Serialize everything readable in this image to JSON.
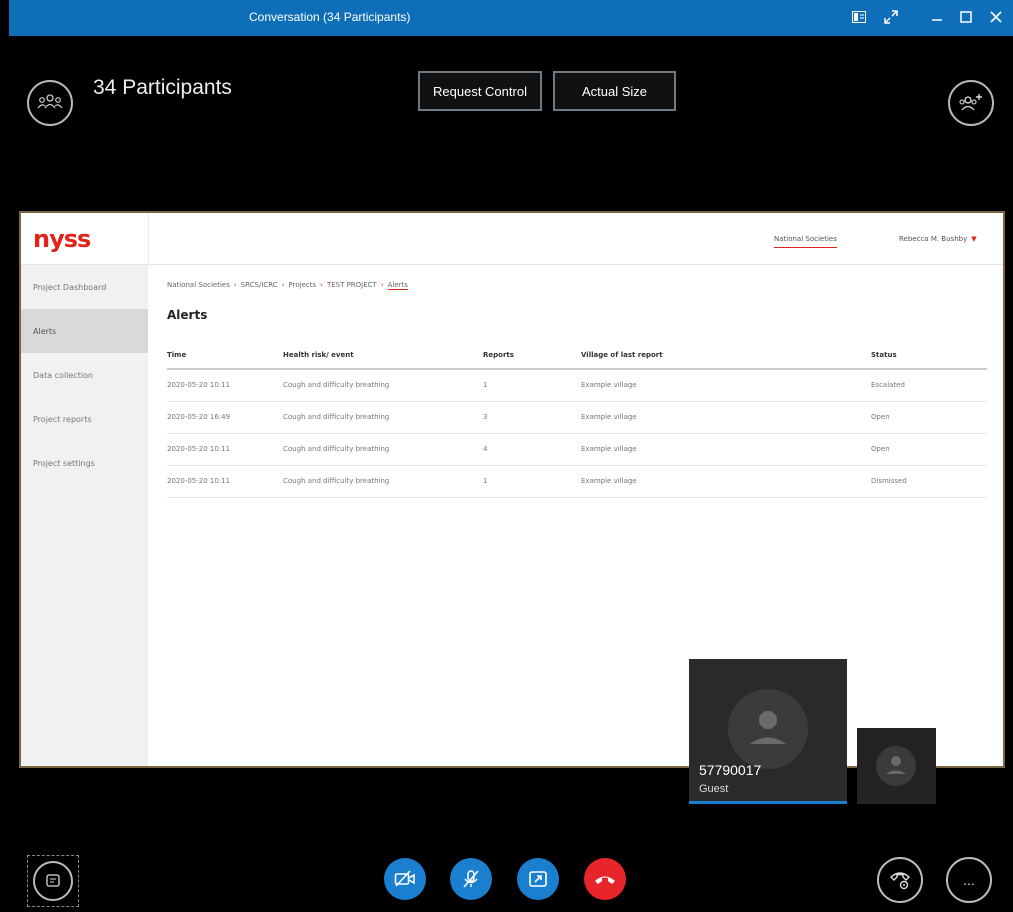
{
  "window": {
    "title": "Conversation (34 Participants)"
  },
  "stage": {
    "participants_label": "34 Participants",
    "request_control": "Request Control",
    "actual_size": "Actual Size"
  },
  "shared_app": {
    "logo": "nyss",
    "header": {
      "national_societies": "National Societies",
      "user_name": "Rebecca M. Bushby"
    },
    "sidebar": {
      "items": [
        {
          "label": "Project Dashboard"
        },
        {
          "label": "Alerts"
        },
        {
          "label": "Data collection"
        },
        {
          "label": "Project reports"
        },
        {
          "label": "Project settings"
        }
      ]
    },
    "breadcrumb": [
      "National Societies",
      "SRCS/ICRC",
      "Projects",
      "TEST PROJECT",
      "Alerts"
    ],
    "page_title": "Alerts",
    "table": {
      "columns": [
        "Time",
        "Health risk/ event",
        "Reports",
        "Village of last report",
        "Status"
      ],
      "rows": [
        [
          "2020-05-20 10:11",
          "Cough and difficulty breathing",
          "1",
          "Example village",
          "Escalated"
        ],
        [
          "2020-05-20 16:49",
          "Cough and difficulty breathing",
          "3",
          "Example village",
          "Open"
        ],
        [
          "2020-05-20 10:11",
          "Cough and difficulty breathing",
          "4",
          "Example village",
          "Open"
        ],
        [
          "2020-05-20 10:11",
          "Cough and difficulty breathing",
          "1",
          "Example village",
          "Dismissed"
        ]
      ]
    }
  },
  "video": {
    "main_tile": {
      "name": "57790017",
      "role": "Guest"
    }
  },
  "controls": {
    "more_label": "...",
    "colors": {
      "blue": "#1b7fd0",
      "red": "#e8252a"
    }
  }
}
